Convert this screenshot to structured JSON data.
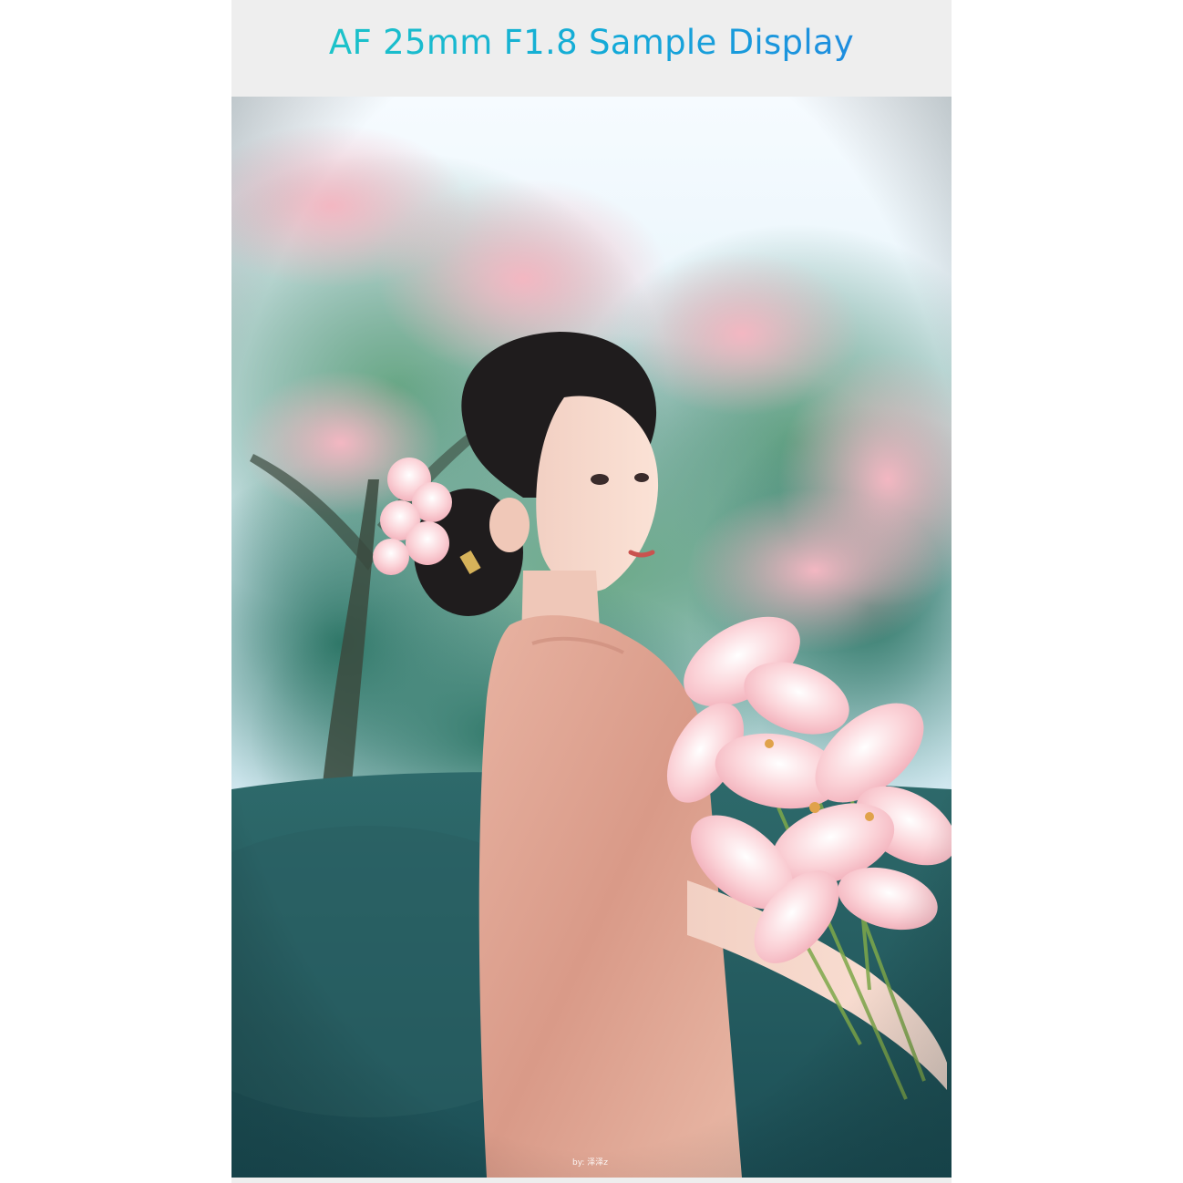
{
  "header": {
    "title": "AF 25mm F1.8 Sample Display"
  },
  "photo": {
    "credit": "by: 泽泽z"
  },
  "colors": {
    "title_gradient_start": "#1cc3c9",
    "title_gradient_end": "#1e8ddf",
    "panel_background": "#eeeeee"
  }
}
